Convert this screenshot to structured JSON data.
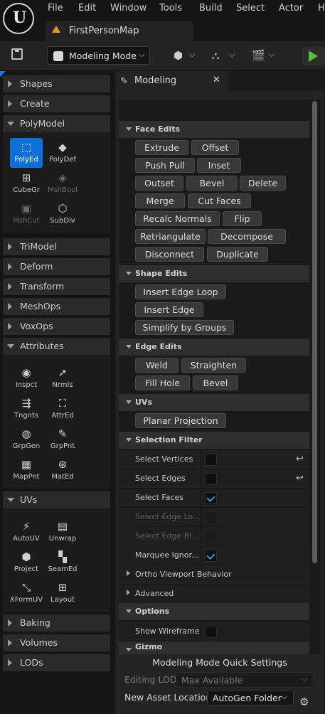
{
  "menubar": {
    "items": [
      "File",
      "Edit",
      "Window",
      "Tools",
      "Build",
      "Select",
      "Actor",
      "H"
    ]
  },
  "tab": {
    "label": "FirstPersonMap"
  },
  "toolbar": {
    "mode_label": "Modeling Mode"
  },
  "left": {
    "categories_top": [
      "Shapes",
      "Create"
    ],
    "polymodel": {
      "label": "PolyModel",
      "tools": [
        {
          "label": "PolyEd",
          "icon": "polyed-icon"
        },
        {
          "label": "PolyDef",
          "icon": "polydef-icon"
        },
        {
          "label": "CubeGr",
          "icon": "cubegr-icon"
        },
        {
          "label": "MshBool",
          "icon": "meshbool-icon"
        },
        {
          "label": "MshCut",
          "icon": "meshcut-icon"
        },
        {
          "label": "SubDiv",
          "icon": "subdiv-icon"
        }
      ]
    },
    "categories_mid": [
      "TriModel",
      "Deform",
      "Transform",
      "MeshOps",
      "VoxOps"
    ],
    "attributes": {
      "label": "Attributes",
      "tools": [
        {
          "label": "Inspct"
        },
        {
          "label": "Nrmls"
        },
        {
          "label": "Tngnts"
        },
        {
          "label": "AttrEd"
        },
        {
          "label": "GrpGen"
        },
        {
          "label": "GrpPnt"
        },
        {
          "label": "MapPnt"
        },
        {
          "label": "MatEd"
        }
      ]
    },
    "uvs": {
      "label": "UVs",
      "tools": [
        {
          "label": "AutoUV"
        },
        {
          "label": "Unwrap"
        },
        {
          "label": "Project"
        },
        {
          "label": "SeamEd"
        },
        {
          "label": "XFormUV"
        },
        {
          "label": "Layout"
        }
      ]
    },
    "categories_bottom": [
      "Baking",
      "Volumes",
      "LODs"
    ]
  },
  "panel": {
    "tab_label": "Modeling",
    "face_edits": {
      "label": "Face Edits",
      "buttons": [
        "Extrude",
        "Offset",
        "Push Pull",
        "Inset",
        "Outset",
        "Bevel",
        "Delete",
        "Merge",
        "Cut Faces",
        "Recalc Normals",
        "Flip",
        "Retriangulate",
        "Decompose",
        "Disconnect",
        "Duplicate"
      ]
    },
    "shape_edits": {
      "label": "Shape Edits",
      "buttons": [
        "Insert Edge Loop",
        "Insert Edge",
        "Simplify by Groups"
      ]
    },
    "edge_edits": {
      "label": "Edge Edits",
      "buttons": [
        "Weld",
        "Straighten",
        "Fill Hole",
        "Bevel"
      ]
    },
    "uvs": {
      "label": "UVs",
      "buttons": [
        "Planar Projection"
      ]
    },
    "selection_filter": {
      "label": "Selection Filter",
      "rows": [
        {
          "label": "Select Vertices",
          "checked": false,
          "enabled": true
        },
        {
          "label": "Select Edges",
          "checked": false,
          "enabled": true
        },
        {
          "label": "Select Faces",
          "checked": true,
          "enabled": true
        },
        {
          "label": "Select Edge Lo...",
          "checked": false,
          "enabled": false
        },
        {
          "label": "Select Edge Ri...",
          "checked": false,
          "enabled": false
        },
        {
          "label": "Marquee Ignor...",
          "checked": true,
          "enabled": true
        }
      ]
    },
    "ortho_label": "Ortho Viewport Behavior",
    "advanced_label": "Advanced",
    "options": {
      "label": "Options",
      "show_wireframe_label": "Show Wireframe",
      "show_wireframe_checked": false
    },
    "gizmo_label": "Gizmo"
  },
  "quick_settings": {
    "title": "Modeling Mode Quick Settings",
    "editing_lod_label": "Editing LOD",
    "editing_lod_value": "Max Available",
    "asset_location_label": "New Asset Location",
    "asset_location_value": "AutoGen Folder"
  }
}
